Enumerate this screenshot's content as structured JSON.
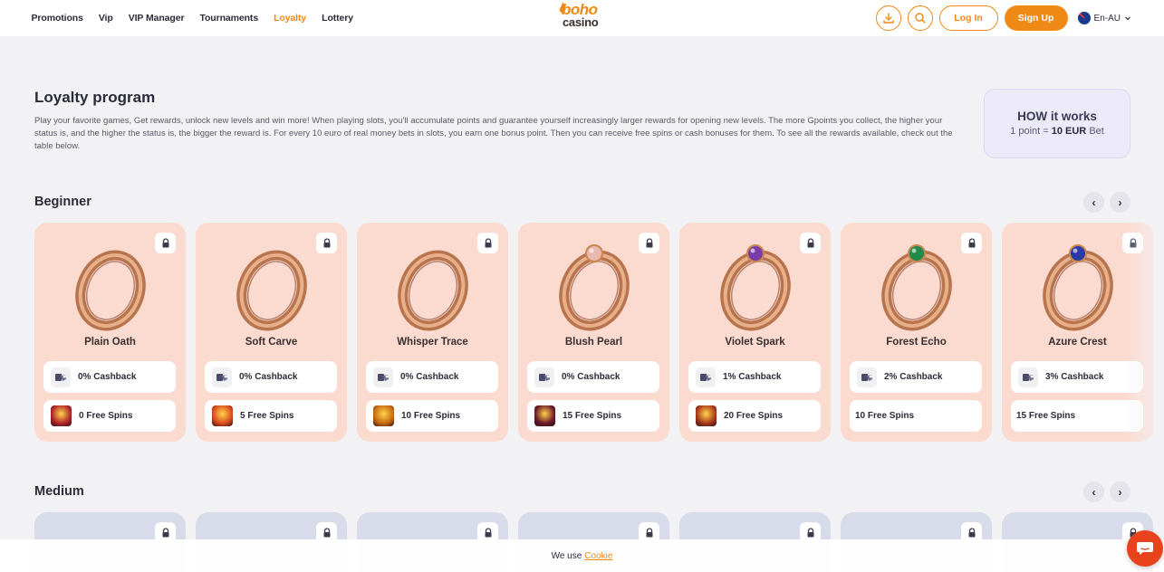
{
  "nav": {
    "items": [
      {
        "label": "Promotions",
        "active": false
      },
      {
        "label": "Vip",
        "active": false
      },
      {
        "label": "VIP Manager",
        "active": false
      },
      {
        "label": "Tournaments",
        "active": false
      },
      {
        "label": "Loyalty",
        "active": true
      },
      {
        "label": "Lottery",
        "active": false
      }
    ]
  },
  "logo": {
    "word1": "boho",
    "word2": "casino"
  },
  "header": {
    "login_label": "Log In",
    "signup_label": "Sign Up",
    "language": "En-AU"
  },
  "intro": {
    "title": "Loyalty program",
    "text": "Play your favorite games, Get rewards, unlock new levels and win more! When playing slots, you'll accumulate points and guarantee yourself increasingly larger rewards for opening new levels. The more Gpoints you collect, the higher your status is, and the higher the status is, the bigger the reward is. For every 10 euro of real money bets in slots, you earn one bonus point. Then you can receive free spins or cash bonuses for them. To see all the rewards available, check out the table below."
  },
  "how": {
    "title": "HOW it works",
    "rate_prefix": "1 point = ",
    "rate_value": "10 EUR",
    "rate_suffix": " Bet"
  },
  "sections": {
    "beginner": {
      "title": "Beginner",
      "prev": "‹",
      "next": "›",
      "cards": [
        {
          "name": "Plain Oath",
          "cashback": "0% Cashback",
          "spins": "0 Free Spins",
          "gem": "",
          "thumb": "#b0232a",
          "has_thumb": true
        },
        {
          "name": "Soft Carve",
          "cashback": "0% Cashback",
          "spins": "5 Free Spins",
          "gem": "",
          "thumb": "#d84a1e",
          "has_thumb": true
        },
        {
          "name": "Whisper Trace",
          "cashback": "0% Cashback",
          "spins": "10 Free Spins",
          "gem": "",
          "thumb": "#c76a10",
          "has_thumb": true
        },
        {
          "name": "Blush Pearl",
          "cashback": "0% Cashback",
          "spins": "15 Free Spins",
          "gem": "#e8b8b0",
          "thumb": "#6a1a2a",
          "has_thumb": true
        },
        {
          "name": "Violet Spark",
          "cashback": "1% Cashback",
          "spins": "20 Free Spins",
          "gem": "#7a3ca8",
          "thumb": "#a8381a",
          "has_thumb": true
        },
        {
          "name": "Forest Echo",
          "cashback": "2% Cashback",
          "spins": "10 Free Spins",
          "gem": "#1f8a4a",
          "thumb": "",
          "has_thumb": false
        },
        {
          "name": "Azure Crest",
          "cashback": "3% Cashback",
          "spins": "15 Free Spins",
          "gem": "#2a3aa8",
          "thumb": "",
          "has_thumb": false
        }
      ]
    },
    "medium": {
      "title": "Medium",
      "prev": "‹",
      "next": "›"
    }
  },
  "cookie": {
    "text": "We use",
    "link": "Cookie"
  },
  "colors": {
    "accent": "#f08a17",
    "card_beginner": "#fbdad0",
    "card_medium": "#d8dbe9"
  }
}
